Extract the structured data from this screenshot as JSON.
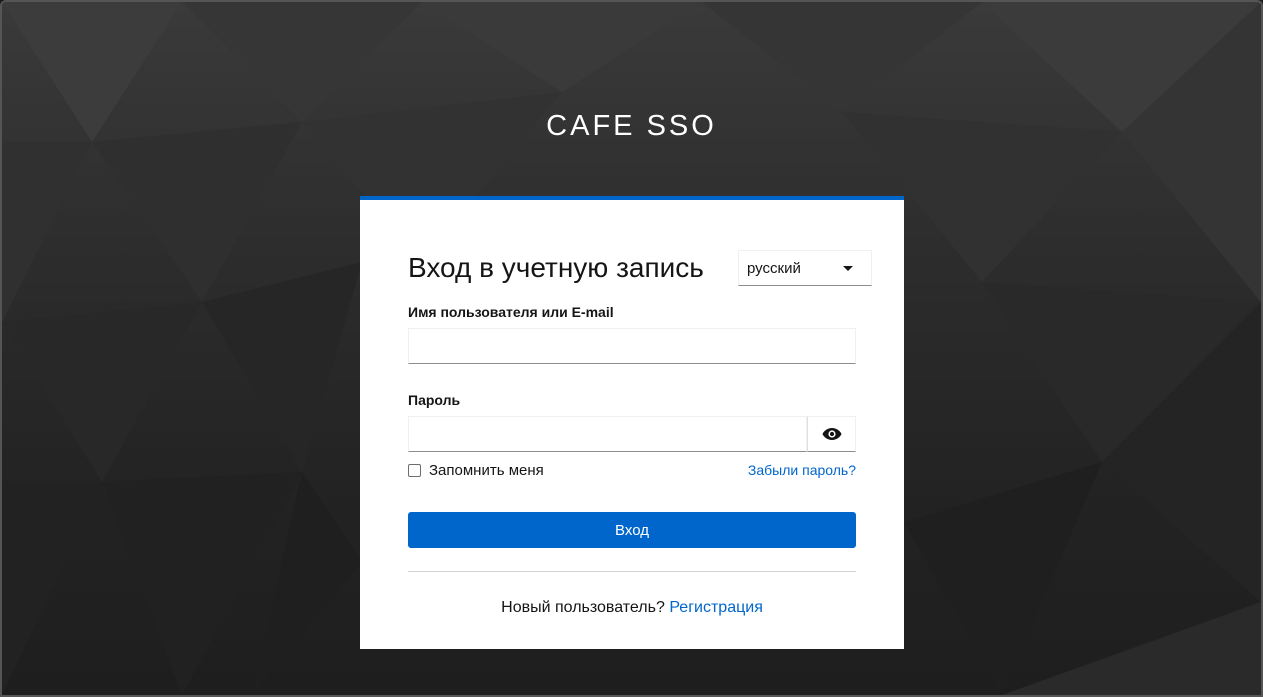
{
  "brand": {
    "title": "CAFE SSO"
  },
  "login": {
    "heading": "Вход в учетную запись",
    "language": {
      "selected": "русский"
    },
    "username_label": "Имя пользователя или E-mail",
    "username_value": "",
    "password_label": "Пароль",
    "password_value": "",
    "remember_label": "Запомнить меня",
    "remember_checked": false,
    "forgot_link": "Забыли пароль?",
    "submit_label": "Вход",
    "new_user_text": "Новый пользователь?",
    "register_link": "Регистрация"
  },
  "colors": {
    "accent": "#0066cc",
    "background": "#262626",
    "card": "#ffffff"
  },
  "icons": {
    "password_toggle": "eye-icon",
    "language_caret": "caret-down-icon"
  }
}
